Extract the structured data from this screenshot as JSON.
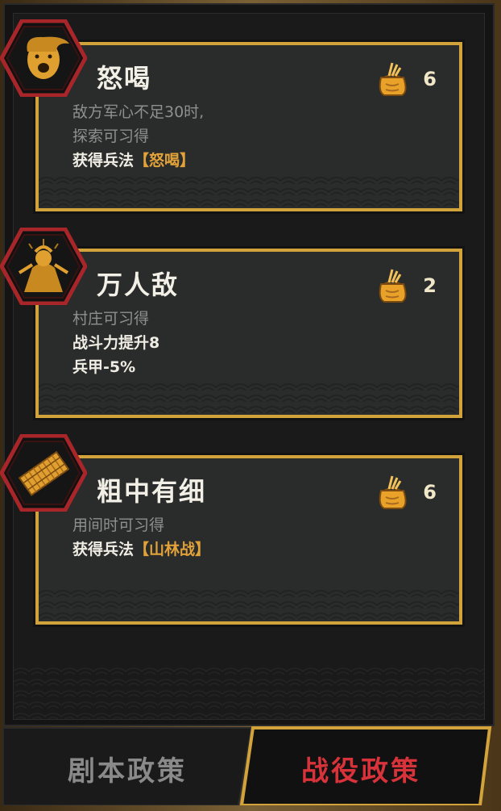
{
  "cards": [
    {
      "title": "怒喝",
      "cost": "6",
      "icon": "shouting-warrior-icon",
      "lines": [
        {
          "text": "敌方军心不足30时,",
          "style": "muted"
        },
        {
          "text": "探索可习得",
          "style": "muted"
        },
        {
          "prefix": "获得兵法",
          "tag": "【怒喝】",
          "style": "bright"
        }
      ]
    },
    {
      "title": "万人敌",
      "cost": "2",
      "icon": "general-warrior-icon",
      "lines": [
        {
          "text": "村庄可习得",
          "style": "muted"
        },
        {
          "text": "战斗力提升8",
          "style": "bright"
        },
        {
          "text": "兵甲-5%",
          "style": "bright"
        }
      ]
    },
    {
      "title": "粗中有细",
      "cost": "6",
      "icon": "bamboo-scroll-icon",
      "lines": [
        {
          "text": "用间时可习得",
          "style": "muted"
        },
        {
          "prefix": "获得兵法",
          "tag": "【山林战】",
          "style": "bright"
        }
      ]
    }
  ],
  "tabs": {
    "script_policy": "剧本政策",
    "campaign_policy": "战役政策"
  },
  "colors": {
    "card_border": "#d2a33b",
    "tag_gold": "#e2a23a",
    "active_tab_text": "#d8323a",
    "inactive_tab_text": "#8a8a8a",
    "hex_border": "#a8262a"
  }
}
